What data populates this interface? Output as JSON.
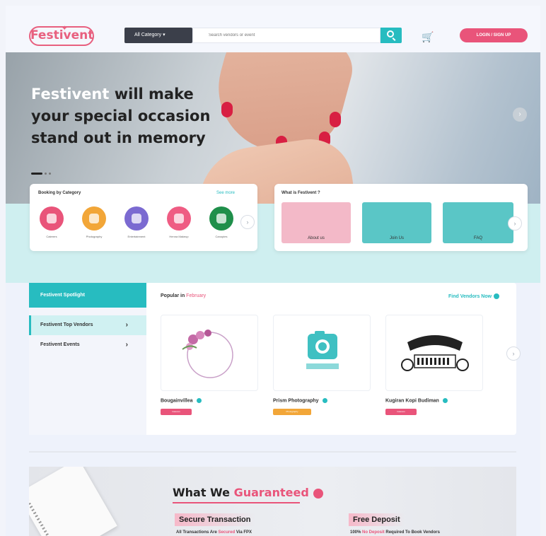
{
  "header": {
    "logo_text": "Festivent",
    "category_label": "All Category ▾",
    "search_placeholder": "Search vendors or event",
    "login_label": "LOGIN / SIGN UP"
  },
  "hero": {
    "brand": "Festivent",
    "line1_rest": " will make",
    "line2": "your special occasion",
    "line3": "stand out in memory",
    "next_label": "›"
  },
  "booking": {
    "title": "Booking by Category",
    "see_more": "See more",
    "categories": [
      {
        "label": "Caterers",
        "color": "#e9547a"
      },
      {
        "label": "Photography",
        "color": "#f2a638"
      },
      {
        "label": "Entertainment",
        "color": "#7b6ad1"
      },
      {
        "label": "Henna Makeup",
        "color": "#ef5c83"
      },
      {
        "label": "Canopies",
        "color": "#1f8f4a"
      }
    ]
  },
  "whatis": {
    "title": "What is Festivent ?",
    "tiles": [
      {
        "label": "About us",
        "color": "#f3b9c8"
      },
      {
        "label": "Join Us",
        "color": "#5ac6c6"
      },
      {
        "label": "FAQ",
        "color": "#5ac6c6"
      }
    ]
  },
  "spotlight": {
    "header": "Festivent Spotlight",
    "items": [
      {
        "label": "Festivent Top Vendors",
        "active": true
      },
      {
        "label": "Festivent Events",
        "active": false
      }
    ],
    "popular_prefix": "Popular in ",
    "popular_month": "February",
    "find_vendors": "Find Vendors Now",
    "vendors": [
      {
        "name": "Bougainvillea",
        "tag": "Caterers",
        "tag_color": "#e9547a"
      },
      {
        "name": "Prism Photography",
        "tag": "Photography",
        "tag_color": "#f2a638"
      },
      {
        "name": "Kugiran Kopi Budiman",
        "tag": "Caterers",
        "tag_color": "#e9547a"
      }
    ]
  },
  "guarantee": {
    "title_prefix": "What We ",
    "title_highlight": "Guaranteed",
    "items": [
      {
        "title": "Secure Transaction",
        "desc_prefix": "All Transactions Are ",
        "desc_highlight": "Secured",
        "desc_suffix": " Via FPX"
      },
      {
        "title": "Free Deposit",
        "desc_prefix": "100% ",
        "desc_highlight": "No Deposit",
        "desc_suffix": " Required To Book Vendors"
      }
    ]
  }
}
